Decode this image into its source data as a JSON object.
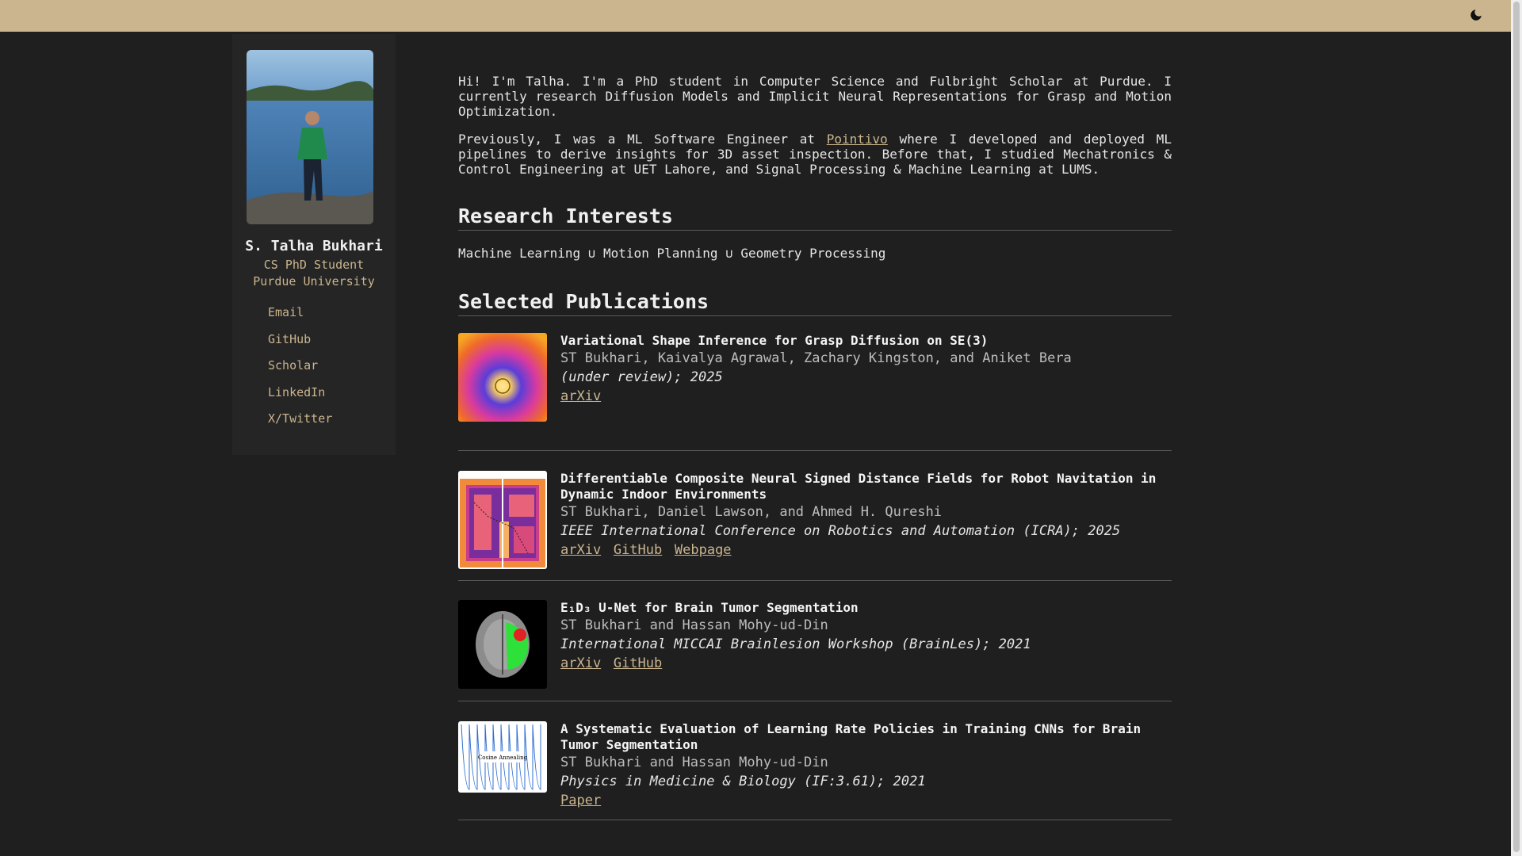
{
  "header": {
    "theme_icon": "moon-icon"
  },
  "sidebar": {
    "name": "S. Talha Bukhari",
    "role": "CS PhD Student",
    "affiliation": "Purdue University",
    "links": [
      "Email",
      "GitHub",
      "Scholar",
      "LinkedIn",
      "X/Twitter"
    ]
  },
  "intro": {
    "p1": "Hi! I'm Talha. I'm a PhD student in Computer Science and Fulbright Scholar at Purdue. I currently research Diffusion Models and Implicit Neural Representations for Grasp and Motion Optimization.",
    "p2_before": "Previously, I was a ML Software Engineer at ",
    "p2_link": "Pointivo",
    "p2_after": " where I developed and deployed ML pipelines to derive insights for 3D asset inspection. Before that, I studied Mechatronics & Control Engineering at UET Lahore, and Signal Processing & Machine Learning at LUMS."
  },
  "research": {
    "heading": "Research Interests",
    "text": "Machine Learning ∪ Motion Planning ∪ Geometry Processing"
  },
  "publications": {
    "heading": "Selected Publications",
    "items": [
      {
        "title": "Variational Shape Inference for Grasp Diffusion on SE(3)",
        "authors": "ST Bukhari, Kaivalya Agrawal, Zachary Kingston, and Aniket Bera",
        "venue": "(under review); 2025",
        "links": [
          "arXiv"
        ]
      },
      {
        "title": "Differentiable Composite Neural Signed Distance Fields for Robot Navitation in Dynamic Indoor Environments",
        "authors": "ST Bukhari, Daniel Lawson, and Ahmed H. Qureshi",
        "venue": "IEEE International Conference on Robotics and Automation (ICRA); 2025",
        "links": [
          "arXiv",
          "GitHub",
          "Webpage"
        ]
      },
      {
        "title": "E₁D₃ U-Net for Brain Tumor Segmentation",
        "authors": "ST Bukhari and Hassan Mohy-ud-Din",
        "venue": "International MICCAI Brainlesion Workshop (BrainLes); 2021",
        "links": [
          "arXiv",
          "GitHub"
        ]
      },
      {
        "title": "A Systematic Evaluation of Learning Rate Policies in Training CNNs for Brain Tumor Segmentation",
        "authors": "ST Bukhari and Hassan Mohy-ud-Din",
        "venue": "Physics in Medicine & Biology (IF:3.61); 2021",
        "links": [
          "Paper"
        ],
        "thumb_label": "Cosine Annealing"
      }
    ]
  }
}
